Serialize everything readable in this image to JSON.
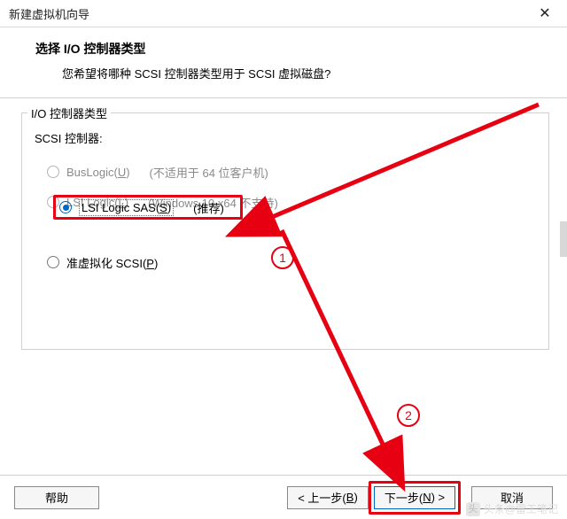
{
  "window": {
    "title": "新建虚拟机向导"
  },
  "header": {
    "heading": "选择 I/O 控制器类型",
    "subheading": "您希望将哪种 SCSI 控制器类型用于 SCSI 虚拟磁盘?"
  },
  "group": {
    "label": "I/O 控制器类型",
    "scsi_label": "SCSI 控制器:",
    "options": [
      {
        "label_pre": "BusLogic(",
        "hotkey": "U",
        "label_post": ")",
        "hint": "(不适用于 64 位客户机)",
        "enabled": false,
        "selected": false
      },
      {
        "label_pre": "LSI Logic(",
        "hotkey": "L",
        "label_post": ")",
        "hint": "(Windows 10 x64 不支持)",
        "enabled": false,
        "selected": false
      },
      {
        "label_pre": "LSI Logic SAS(",
        "hotkey": "S",
        "label_post": ")",
        "hint": "(推荐)",
        "enabled": true,
        "selected": true
      },
      {
        "label_pre": "准虚拟化 SCSI(",
        "hotkey": "P",
        "label_post": ")",
        "hint": "",
        "enabled": true,
        "selected": false
      }
    ]
  },
  "buttons": {
    "help": "帮助",
    "back_pre": "< 上一步(",
    "back_hotkey": "B",
    "back_post": ")",
    "next_pre": "下一步(",
    "next_hotkey": "N",
    "next_post": ") >",
    "cancel": "取消"
  },
  "annotations": {
    "step1": "1",
    "step2": "2"
  },
  "watermark": {
    "logo": "头",
    "prefix": "头条",
    "text": "@雷工笔记"
  }
}
